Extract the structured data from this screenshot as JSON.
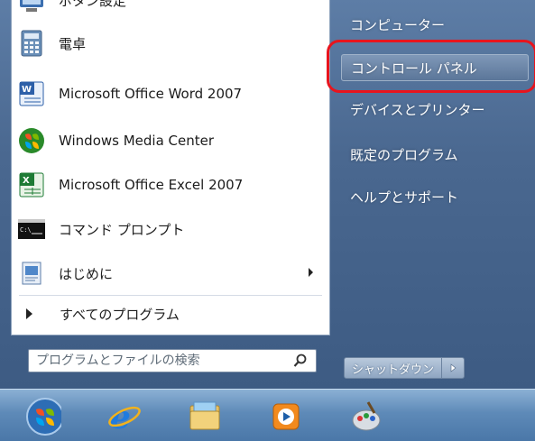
{
  "left_menu": {
    "items": [
      {
        "label": "ボタン設定",
        "icon": "sync-center-icon"
      },
      {
        "label": "電卓",
        "icon": "calculator-icon"
      },
      {
        "label": "Microsoft Office Word 2007",
        "icon": "word-icon"
      },
      {
        "label": "Windows Media Center",
        "icon": "media-center-icon"
      },
      {
        "label": "Microsoft Office Excel 2007",
        "icon": "excel-icon"
      },
      {
        "label": "コマンド プロンプト",
        "icon": "command-prompt-icon"
      },
      {
        "label": "はじめに",
        "icon": "getting-started-icon"
      }
    ],
    "all_programs_label": "すべてのプログラム"
  },
  "search": {
    "placeholder": "プログラムとファイルの検索"
  },
  "right_menu": {
    "items": [
      {
        "label": "コンピューター"
      },
      {
        "label": "コントロール パネル"
      },
      {
        "label": "デバイスとプリンター"
      },
      {
        "label": "既定のプログラム"
      },
      {
        "label": "ヘルプとサポート"
      }
    ]
  },
  "shutdown": {
    "label": "シャットダウン"
  },
  "taskbar": {
    "icons": [
      "start-orb-icon",
      "internet-explorer-icon",
      "file-explorer-icon",
      "media-player-icon",
      "paint-icon"
    ]
  },
  "colors": {
    "highlight_ring": "#e8141d",
    "menu_blue": "#4a6890"
  }
}
